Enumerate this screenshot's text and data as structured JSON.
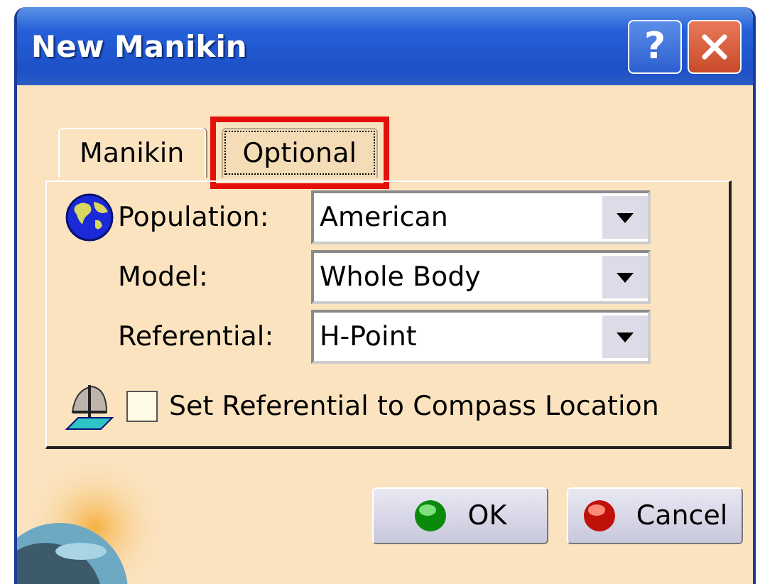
{
  "window": {
    "title": "New Manikin",
    "buttons": [
      {
        "kind": "help",
        "label": "?"
      },
      {
        "kind": "close"
      }
    ]
  },
  "tabs": [
    {
      "label": "Manikin",
      "selected": true,
      "highlighted": false
    },
    {
      "label": "Optional",
      "selected": false,
      "highlighted": true
    }
  ],
  "fields": [
    {
      "label": "Population:",
      "value": "American"
    },
    {
      "label": "Model:",
      "value": "Whole Body"
    },
    {
      "label": "Referential:",
      "value": "H-Point"
    }
  ],
  "compass_option": {
    "label": "Set Referential to Compass Location",
    "checked": false
  },
  "buttons": [
    {
      "label": "OK",
      "kind": "ok"
    },
    {
      "label": "Cancel",
      "kind": "cancel"
    }
  ]
}
